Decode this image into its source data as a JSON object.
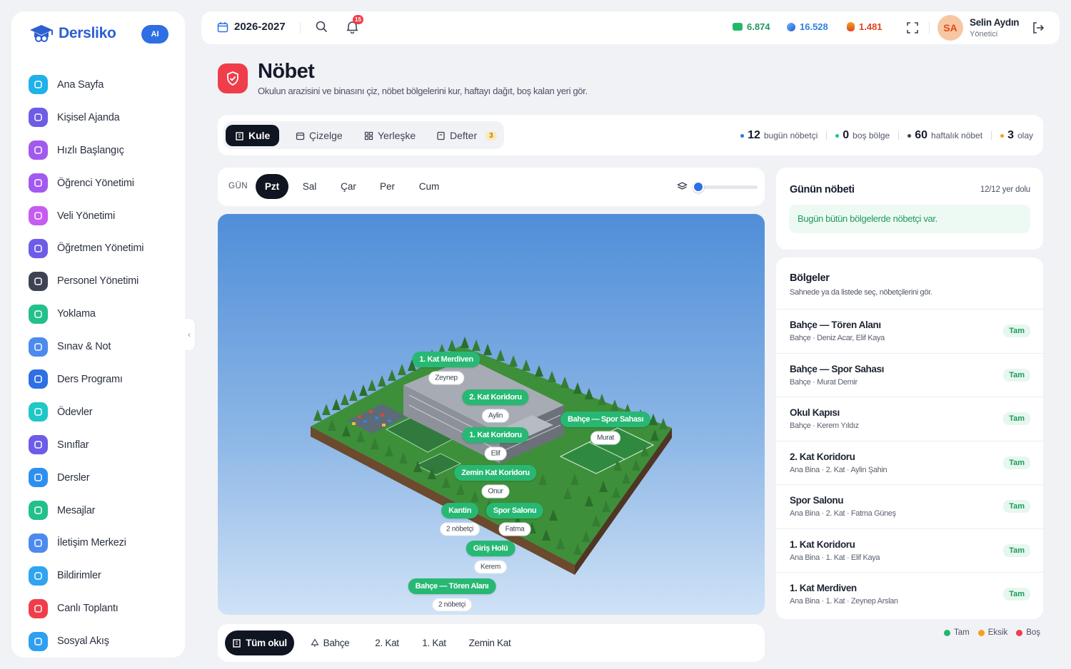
{
  "app": {
    "name": "Dersliko",
    "ai_badge": "AI"
  },
  "sidebar": {
    "items": [
      {
        "label": "Ana Sayfa",
        "icon": "home-icon",
        "color": "#1fb1ea"
      },
      {
        "label": "Kişisel Ajanda",
        "icon": "calendar-icon",
        "color": "#6d5ce8"
      },
      {
        "label": "Hızlı Başlangıç",
        "icon": "play-icon",
        "color": "#a259f0"
      },
      {
        "label": "Öğrenci Yönetimi",
        "icon": "users-icon",
        "color": "#a259f0"
      },
      {
        "label": "Veli Yönetimi",
        "icon": "parents-icon",
        "color": "#c75cf0"
      },
      {
        "label": "Öğretmen Yönetimi",
        "icon": "teacher-icon",
        "color": "#6d5ce8"
      },
      {
        "label": "Personel Yönetimi",
        "icon": "id-card-icon",
        "color": "#3d4352"
      },
      {
        "label": "Yoklama",
        "icon": "clipboard-check-icon",
        "color": "#22c08a"
      },
      {
        "label": "Sınav & Not",
        "icon": "exam-icon",
        "color": "#4c8af0"
      },
      {
        "label": "Ders Programı",
        "icon": "schedule-icon",
        "color": "#2f6fe4"
      },
      {
        "label": "Ödevler",
        "icon": "homework-icon",
        "color": "#1fc7c7"
      },
      {
        "label": "Sınıflar",
        "icon": "monitor-icon",
        "color": "#6d5ce8"
      },
      {
        "label": "Dersler",
        "icon": "book-icon",
        "color": "#2f8ff0"
      },
      {
        "label": "Mesajlar",
        "icon": "chat-icon",
        "color": "#22c08a"
      },
      {
        "label": "İletişim Merkezi",
        "icon": "megaphone-icon",
        "color": "#4c8af0"
      },
      {
        "label": "Bildirimler",
        "icon": "bell-icon",
        "color": "#2fa4f0"
      },
      {
        "label": "Canlı Toplantı",
        "icon": "broadcast-icon",
        "color": "#ef3e4a"
      },
      {
        "label": "Sosyal Akış",
        "icon": "rss-icon",
        "color": "#2f9ff0"
      }
    ]
  },
  "topbar": {
    "year": "2026-2027",
    "notifications": "15",
    "stats": [
      {
        "value": "6.874",
        "color": "#1f9a5d",
        "icon": "cash-icon"
      },
      {
        "value": "16.528",
        "color": "#2f7fe0",
        "icon": "gem-icon"
      },
      {
        "value": "1.481",
        "color": "#e0451f",
        "icon": "fire-icon"
      }
    ],
    "user": {
      "initials": "SA",
      "name": "Selin Aydın",
      "role": "Yönetici"
    }
  },
  "page": {
    "title": "Nöbet",
    "subtitle": "Okulun arazisini ve binasını çiz, nöbet bölgelerini kur, haftayı dağıt, boş kalan yeri gör."
  },
  "view_tabs": [
    {
      "label": "Kule",
      "icon": "building-icon"
    },
    {
      "label": "Çizelge",
      "icon": "calendar-icon"
    },
    {
      "label": "Yerleşke",
      "icon": "grid-icon"
    },
    {
      "label": "Defter",
      "icon": "notebook-icon",
      "badge": "3"
    }
  ],
  "kpis": [
    {
      "value": "12",
      "label": "bugün nöbetçi",
      "color": "#2f6fe4"
    },
    {
      "value": "0",
      "label": "boş bölge",
      "color": "#22c08a"
    },
    {
      "value": "60",
      "label": "haftalık nöbet",
      "color": "#3b4252"
    },
    {
      "value": "3",
      "label": "olay",
      "color": "#f0a020"
    }
  ],
  "daybar": {
    "label": "GÜN",
    "days": [
      "Pzt",
      "Sal",
      "Çar",
      "Per",
      "Cum"
    ],
    "active": "Pzt",
    "layer_level": 0
  },
  "scene": {
    "tags": [
      {
        "zone": "1. Kat Merdiven",
        "staff": "Zeynep"
      },
      {
        "zone": "2. Kat Koridoru",
        "staff": "Aylin"
      },
      {
        "zone": "Bahçe — Spor Sahası",
        "staff": "Murat"
      },
      {
        "zone": "1. Kat Koridoru",
        "staff": "Elif"
      },
      {
        "zone": "Zemin Kat Koridoru",
        "staff": "Onur"
      },
      {
        "zone": "Kantin",
        "staff": "2 nöbetçi"
      },
      {
        "zone": "Spor Salonu",
        "staff": "Fatma"
      },
      {
        "zone": "Giriş Holü",
        "staff": "Kerem"
      },
      {
        "zone": "Bahçe — Tören Alanı",
        "staff": "2 nöbetçi"
      }
    ]
  },
  "floors": [
    {
      "label": "Tüm okul",
      "icon": "building-icon"
    },
    {
      "label": "Bahçe",
      "icon": "tree-icon"
    },
    {
      "label": "2. Kat"
    },
    {
      "label": "1. Kat"
    },
    {
      "label": "Zemin Kat"
    }
  ],
  "duty": {
    "title": "Günün nöbeti",
    "count": "12/12 yer dolu",
    "message": "Bugün bütün bölgelerde nöbetçi var."
  },
  "zones": {
    "title": "Bölgeler",
    "subtitle": "Sahnede ya da listede seç, nöbetçilerini gör.",
    "items": [
      {
        "name": "Bahçe — Tören Alanı",
        "meta": "Bahçe · Deniz Acar, Elif Kaya",
        "status": "Tam"
      },
      {
        "name": "Bahçe — Spor Sahası",
        "meta": "Bahçe · Murat Demir",
        "status": "Tam"
      },
      {
        "name": "Okul Kapısı",
        "meta": "Bahçe · Kerem Yıldız",
        "status": "Tam"
      },
      {
        "name": "2. Kat Koridoru",
        "meta": "Ana Bina · 2. Kat · Aylin Şahin",
        "status": "Tam"
      },
      {
        "name": "Spor Salonu",
        "meta": "Ana Bina · 2. Kat · Fatma Güneş",
        "status": "Tam"
      },
      {
        "name": "1. Kat Koridoru",
        "meta": "Ana Bina · 1. Kat · Elif Kaya",
        "status": "Tam"
      },
      {
        "name": "1. Kat Merdiven",
        "meta": "Ana Bina · 1. Kat · Zeynep Arslan",
        "status": "Tam"
      }
    ]
  },
  "legend": [
    {
      "label": "Tam",
      "color": "#22b86c"
    },
    {
      "label": "Eksik",
      "color": "#f5a020"
    },
    {
      "label": "Boş",
      "color": "#ef3e4a"
    }
  ],
  "colors": {
    "accent": "#2f6fe4",
    "danger": "#ef3e4a",
    "success": "#22b86c",
    "dark": "#101522"
  }
}
